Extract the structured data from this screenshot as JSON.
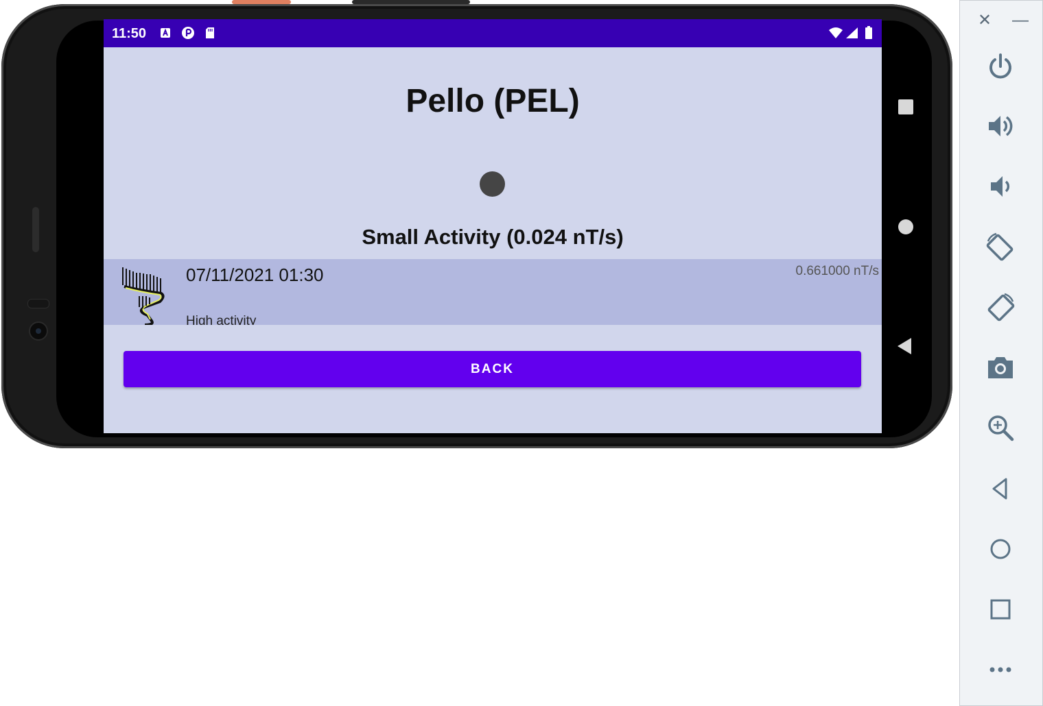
{
  "status_bar": {
    "time": "11:50"
  },
  "station": {
    "title": "Pello (PEL)"
  },
  "current": {
    "activity_label": "Small Activity (0.024 nT/s)"
  },
  "list": {
    "items": [
      {
        "datetime": "07/11/2021 01:30",
        "rate": "0.661000 nT/s",
        "description": "High activity"
      }
    ]
  },
  "buttons": {
    "back": "BACK"
  },
  "colors": {
    "status_bar": "#3700b3",
    "screen_bg": "#d1d6ec",
    "list_item_bg": "#b2b8df",
    "button": "#6200ee",
    "sidebar_icon": "#5c7487"
  },
  "emulator_toolbar": {
    "icons": [
      "close-icon",
      "minimize-icon",
      "power-icon",
      "volume-up-icon",
      "volume-down-icon",
      "rotate-left-icon",
      "rotate-right-icon",
      "camera-icon",
      "zoom-icon",
      "back-icon",
      "home-icon",
      "overview-icon",
      "more-icon"
    ]
  }
}
